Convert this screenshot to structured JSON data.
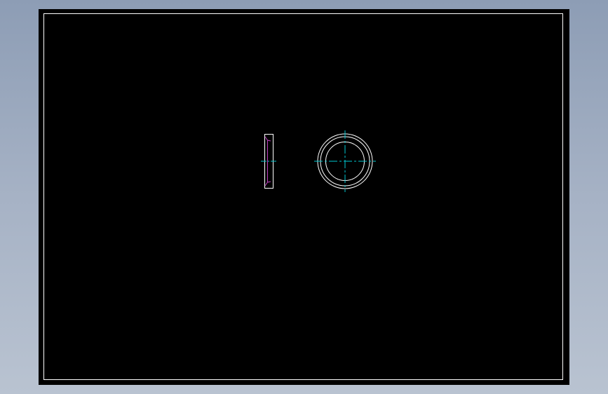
{
  "colors": {
    "background_gradient_top": "#8d9db5",
    "background_gradient_bottom": "#b9c3d1",
    "sheet": "#000000",
    "geometry": "#ffffff",
    "centerline": "#00c8d2",
    "hidden_line": "#c040c0"
  },
  "views": [
    "side-view",
    "front-view"
  ]
}
